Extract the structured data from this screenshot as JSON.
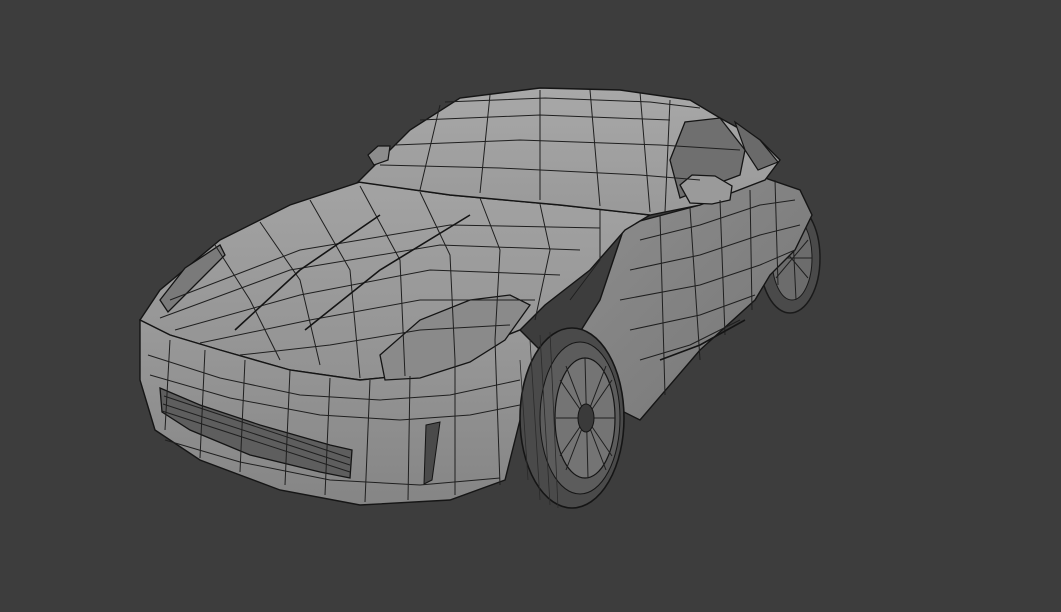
{
  "viewport": {
    "background_color": "#3d3d3d",
    "subject": "car-mesh"
  },
  "colors": {
    "body_light": "#9d9d9d",
    "body_mid": "#8a8a8a",
    "body_dark": "#6f6f6f",
    "glass": "#7c7c7c",
    "tire": "#4b4b4b",
    "wire": "#1f1f1f"
  }
}
